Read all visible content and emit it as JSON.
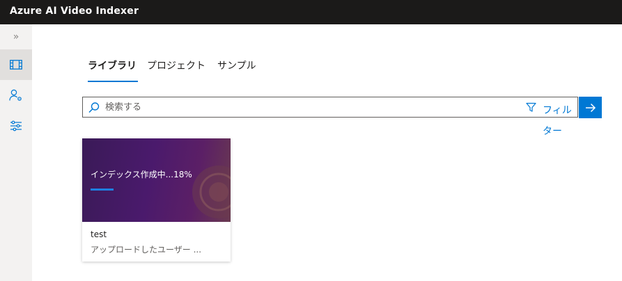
{
  "app": {
    "title": "Azure AI Video Indexer"
  },
  "sidebar": {
    "items": [
      {
        "icon": "chevron-double-right-icon",
        "glyph": "»"
      },
      {
        "icon": "film-icon"
      },
      {
        "icon": "people-settings-icon"
      },
      {
        "icon": "sliders-icon"
      }
    ]
  },
  "tabs": [
    {
      "label": "ライブラリ",
      "active": true
    },
    {
      "label": "プロジェクト",
      "active": false
    },
    {
      "label": "サンプル",
      "active": false
    }
  ],
  "search": {
    "placeholder": "検索する",
    "filter_label": "フィルター"
  },
  "videos": [
    {
      "status": "インデックス作成中...18%",
      "progress": 0.18,
      "title": "test",
      "subtitle": "アップロードしたユーザー ..."
    }
  ],
  "colors": {
    "accent": "#0078d4",
    "topbar": "#1b1a19",
    "sidebar": "#f3f2f1"
  }
}
